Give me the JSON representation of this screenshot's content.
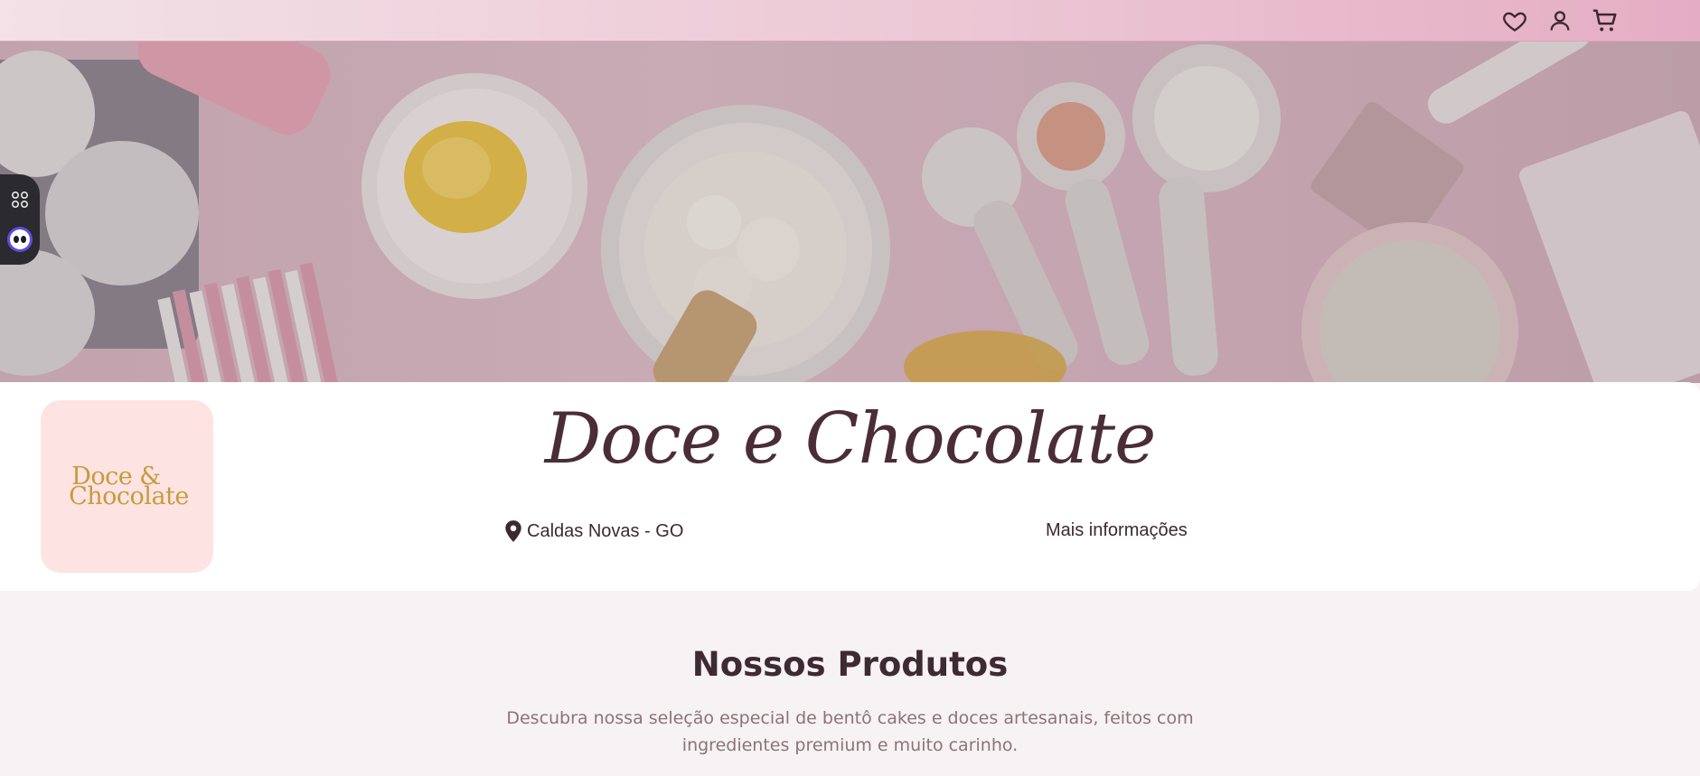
{
  "topbar": {
    "icons": [
      "heart-icon",
      "user-icon",
      "cart-icon"
    ]
  },
  "side_widget": {
    "icons": [
      "grid-icon",
      "assistant-icon"
    ]
  },
  "profile": {
    "logo_line1": "Doce &",
    "logo_line2": "Chocolate",
    "title": "Doce e Chocolate",
    "location": "Caldas Novas - GO",
    "more_info": "Mais informações"
  },
  "products": {
    "title": "Nossos Produtos",
    "description": "Descubra nossa seleção especial de bentô cakes e doces artesanais, feitos com ingredientes premium e muito carinho."
  },
  "colors": {
    "title_text": "#4a2d37",
    "logo_gold": "#c99a3c",
    "logo_bg": "#fde4e3",
    "topbar_pink": "#e5adc3",
    "page_bg": "#f7f2f3"
  }
}
